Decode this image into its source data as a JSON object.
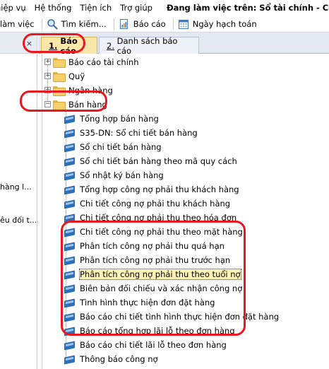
{
  "menu": {
    "items": [
      "hiệp vụ",
      "Hệ thống",
      "Tiện ích",
      "Trợ giúp"
    ],
    "company": "Đang làm việc trên: Sổ tài chính - Công T"
  },
  "toolbar": {
    "items": [
      "làm việc",
      "Tìm kiếm...",
      "Báo cáo",
      "Ngày hạch toán"
    ]
  },
  "left_panel": {
    "close": "×",
    "texts": [
      "hàng l...",
      "êu đối t..."
    ]
  },
  "tabs": [
    {
      "num": "1.",
      "label": "Báo cáo"
    },
    {
      "num": "2.",
      "label": "Danh sách báo cáo"
    }
  ],
  "tree": {
    "folders": [
      "Báo cáo tài chính",
      "Quỹ",
      "Ngân hàng",
      "Bán hàng"
    ],
    "reports": [
      "Tổng hợp bán hàng",
      "S35-DN: Sổ chi tiết bán hàng",
      "Sổ chi tiết bán hàng",
      "Sổ chi tiết bán hàng theo mã quy cách",
      "Sổ nhật ký bán hàng",
      "Tổng hợp công nợ phải thu khách hàng",
      "Chi tiết công nợ phải thu khách hàng",
      "Chi tiết công nợ phải thu theo hóa đơn",
      "Chi tiết công nợ phải thu theo mặt hàng",
      "Phân tích công nợ phải thu quá hạn",
      "Phân tích công nợ phải thu trước hạn",
      "Phân tích công nợ phải thu theo tuổi nợ",
      "Biên bản đối chiếu và xác nhận công nợ",
      "Tình hình thực hiện đơn đặt hàng",
      "Báo cáo chi tiết tình hình thực hiện đơn đặt hàng",
      "Báo cáo tổng hợp lãi lỗ theo đơn hàng",
      "Báo cáo chi tiết lãi lỗ theo đơn hàng",
      "Thông báo công nợ"
    ]
  },
  "colors": {
    "highlight": "#e5191f",
    "tab_active": "#fbe7a8",
    "book_icon": "#2f6fb7"
  }
}
